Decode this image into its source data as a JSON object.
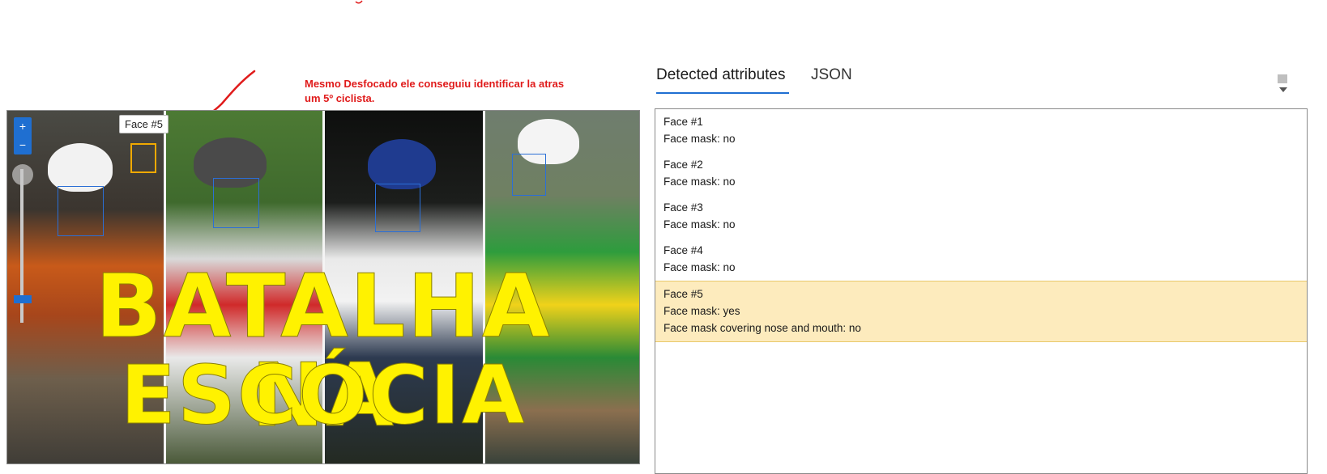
{
  "annotation": {
    "text": "Mesmo Desfocado ele conseguiu identificar la atras um 5º ciclista."
  },
  "image": {
    "tooltip": "Face #5",
    "headline_line1": "BATALHA NA",
    "headline_line2": "ESCÓCIA",
    "zoom_in": "+",
    "zoom_out": "−"
  },
  "tabs": [
    {
      "label": "Detected attributes"
    },
    {
      "label": "JSON"
    }
  ],
  "faces": [
    {
      "title": "Face #1",
      "mask": "Face mask: no"
    },
    {
      "title": "Face #2",
      "mask": "Face mask: no"
    },
    {
      "title": "Face #3",
      "mask": "Face mask: no"
    },
    {
      "title": "Face #4",
      "mask": "Face mask: no"
    },
    {
      "title": "Face #5",
      "mask": "Face mask: yes",
      "covering": "Face mask covering nose and mouth: no"
    }
  ],
  "colors": {
    "accent": "#1f6fd1",
    "highlight_bg": "#fdebbd",
    "annotation_red": "#e01b1b",
    "headline_yellow": "#fff200"
  }
}
